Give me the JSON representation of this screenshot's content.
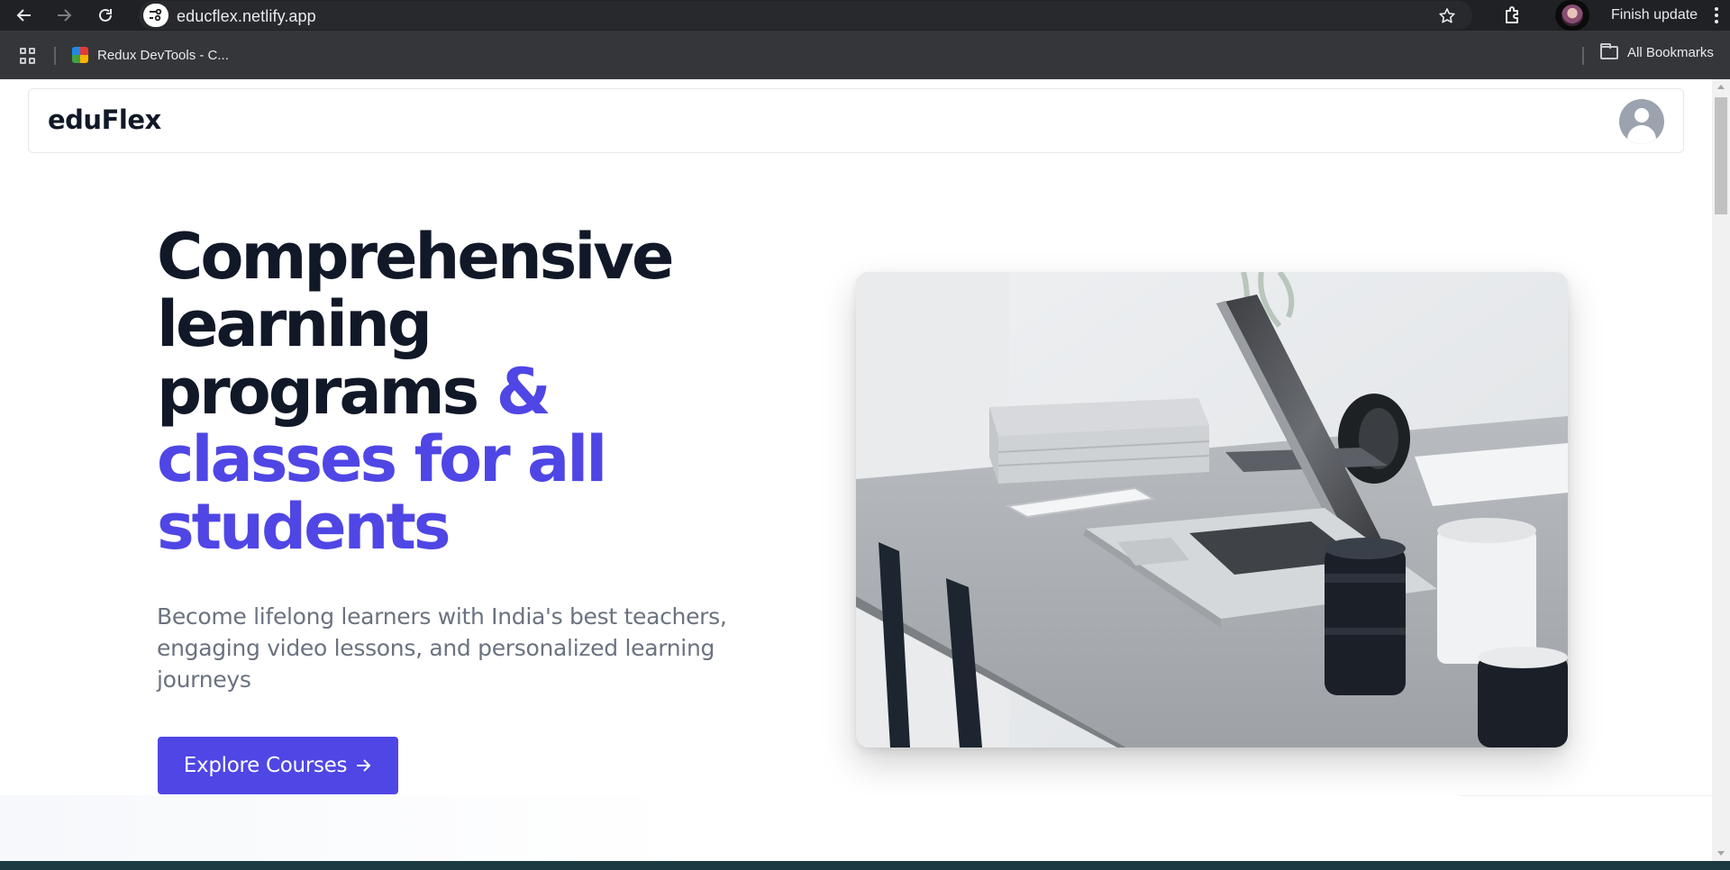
{
  "browser": {
    "url": "educflex.netlify.app",
    "finish_update_label": "Finish update",
    "bookmarks": [
      {
        "label": "Redux DevTools - C..."
      }
    ],
    "all_bookmarks_label": "All Bookmarks"
  },
  "site": {
    "logo": "eduFlex",
    "hero": {
      "title_dark_1": "Comprehensive",
      "title_dark_2": "learning",
      "title_dark_3": "programs",
      "title_accent_1": "&",
      "title_accent_2": "classes for all",
      "title_accent_3": "students",
      "subtitle": "Become lifelong learners with India's best teachers, engaging video lessons, and personalized learning journeys",
      "cta_label": "Explore Courses"
    }
  },
  "colors": {
    "accent": "#4f46e5",
    "heading": "#111827",
    "muted_text": "#6b7280",
    "chrome_bg": "#202124"
  },
  "icons": [
    "back-arrow-icon",
    "forward-arrow-icon",
    "reload-icon",
    "site-info-icon",
    "star-icon",
    "extensions-icon",
    "kebab-menu-icon",
    "apps-grid-icon",
    "folder-icon",
    "user-avatar-icon",
    "arrow-right-icon"
  ]
}
